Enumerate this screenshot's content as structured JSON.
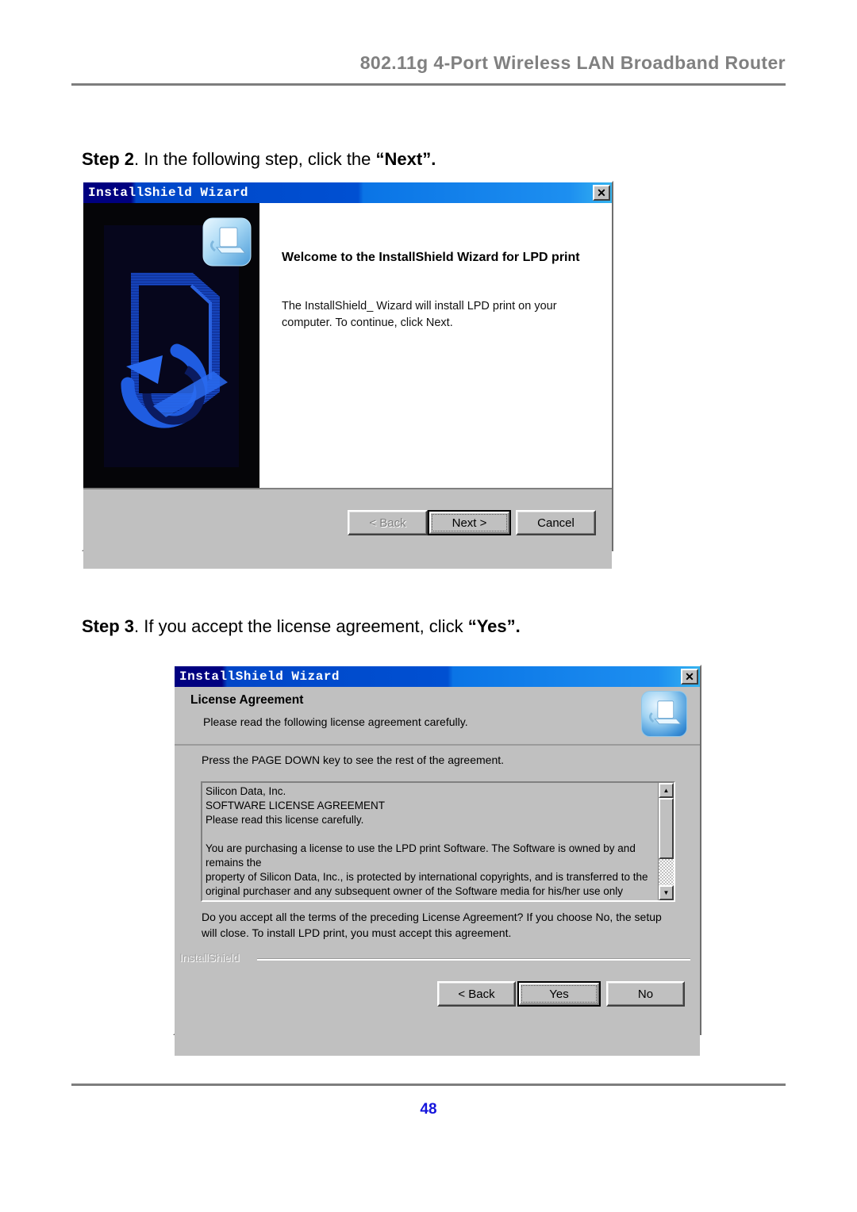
{
  "page": {
    "header_title": "802.11g 4-Port Wireless LAN Broadband Router",
    "number": "48"
  },
  "steps": {
    "step2": {
      "label": "Step 2",
      "text": ". In the following step, click the ",
      "emphasis": "“Next”."
    },
    "step3": {
      "label": "Step 3",
      "text": ". If you accept the license agreement, click ",
      "emphasis": "“Yes”."
    }
  },
  "dialog_welcome": {
    "title": "InstallShield Wizard",
    "close_label": "✕",
    "heading": "Welcome to the InstallShield Wizard for LPD print",
    "body": "The InstallShield_ Wizard will install LPD print on your computer.  To continue, click Next.",
    "buttons": {
      "back": "< Back",
      "next": "Next >",
      "cancel": "Cancel"
    }
  },
  "dialog_license": {
    "title": "InstallShield Wizard",
    "close_label": "✕",
    "heading": "License Agreement",
    "subheading": "Please read the following license agreement carefully.",
    "prompt": "Press the PAGE DOWN key to see the rest of the agreement.",
    "agreement_text": "Silicon Data, Inc.\nSOFTWARE LICENSE AGREEMENT\nPlease read this license carefully.\n\nYou are purchasing a license to use the LPD print Software. The Software is owned by and remains the\nproperty of Silicon Data, Inc., is protected by international copyrights, and is transferred to the\noriginal purchaser and any subsequent owner of the Software media for his/her use only according to\nthe license terms set forth below. Opening the packaging and/or using the Software indicates",
    "question": "Do you accept all the terms of the preceding License Agreement?  If you choose No,  the setup will close.  To install LPD print, you must accept this agreement.",
    "watermark": "InstallShield",
    "scroll_up_glyph": "▲",
    "scroll_down_glyph": "▼",
    "buttons": {
      "back": "< Back",
      "yes": "Yes",
      "no": "No"
    }
  },
  "colors": {
    "accent_blue": "#1414dc",
    "header_gray": "#808080",
    "dialog_face": "#c0c0c0",
    "titlebar_navy": "#000080",
    "banner_black": "#050508"
  }
}
